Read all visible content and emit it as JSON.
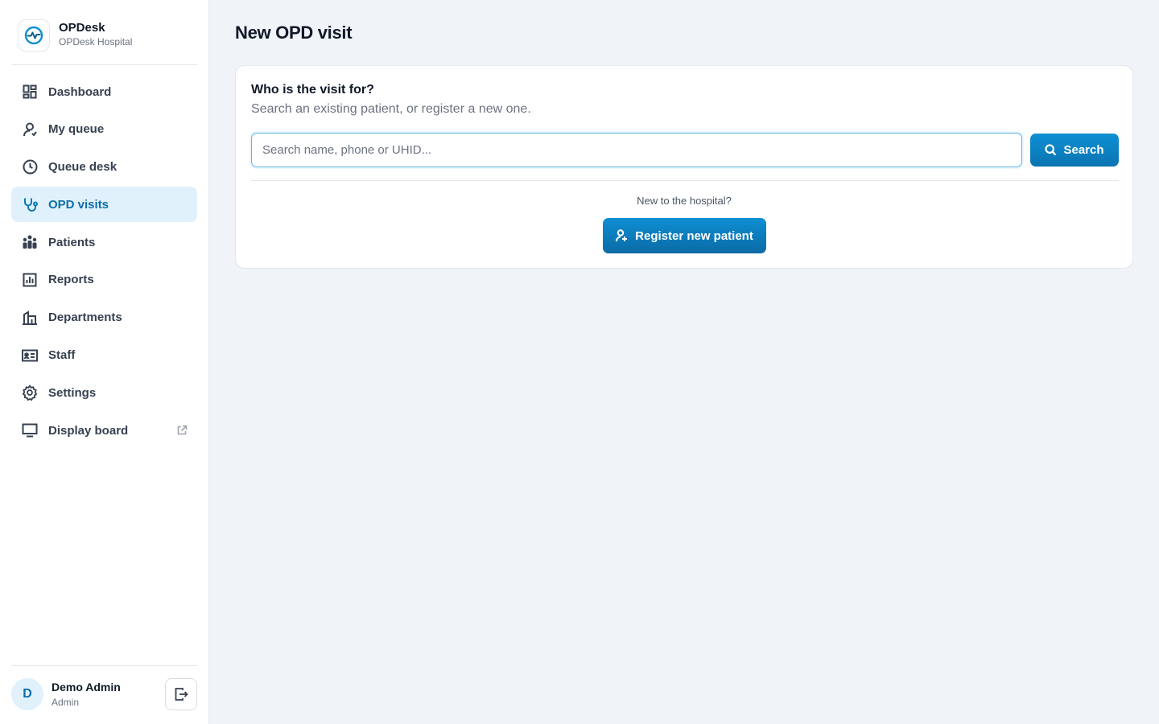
{
  "brand": {
    "name": "OPDesk",
    "hospital": "OPDesk Hospital",
    "logo_icon": "heartbeat-logo-icon",
    "accent_color": "#0e8fd3"
  },
  "sidebar": {
    "items": [
      {
        "label": "Dashboard",
        "icon": "dashboard-icon",
        "active": false
      },
      {
        "label": "My queue",
        "icon": "user-icon",
        "active": false
      },
      {
        "label": "Queue desk",
        "icon": "clock-icon",
        "active": false
      },
      {
        "label": "OPD visits",
        "icon": "stethoscope-icon",
        "active": true
      },
      {
        "label": "Patients",
        "icon": "people-icon",
        "active": false
      },
      {
        "label": "Reports",
        "icon": "bar-chart-icon",
        "active": false
      },
      {
        "label": "Departments",
        "icon": "building-icon",
        "active": false
      },
      {
        "label": "Staff",
        "icon": "id-card-icon",
        "active": false
      },
      {
        "label": "Settings",
        "icon": "gear-icon",
        "active": false
      },
      {
        "label": "Display board",
        "icon": "monitor-icon",
        "active": false,
        "external": true
      }
    ]
  },
  "user": {
    "initial": "D",
    "name": "Demo Admin",
    "role": "Admin"
  },
  "main": {
    "title": "New OPD visit",
    "card": {
      "heading": "Who is the visit for?",
      "subheading": "Search an existing patient, or register a new one.",
      "search_placeholder": "Search name, phone or UHID...",
      "search_value": "",
      "search_button": "Search",
      "new_question": "New to the hospital?",
      "register_button": "Register new patient"
    }
  }
}
